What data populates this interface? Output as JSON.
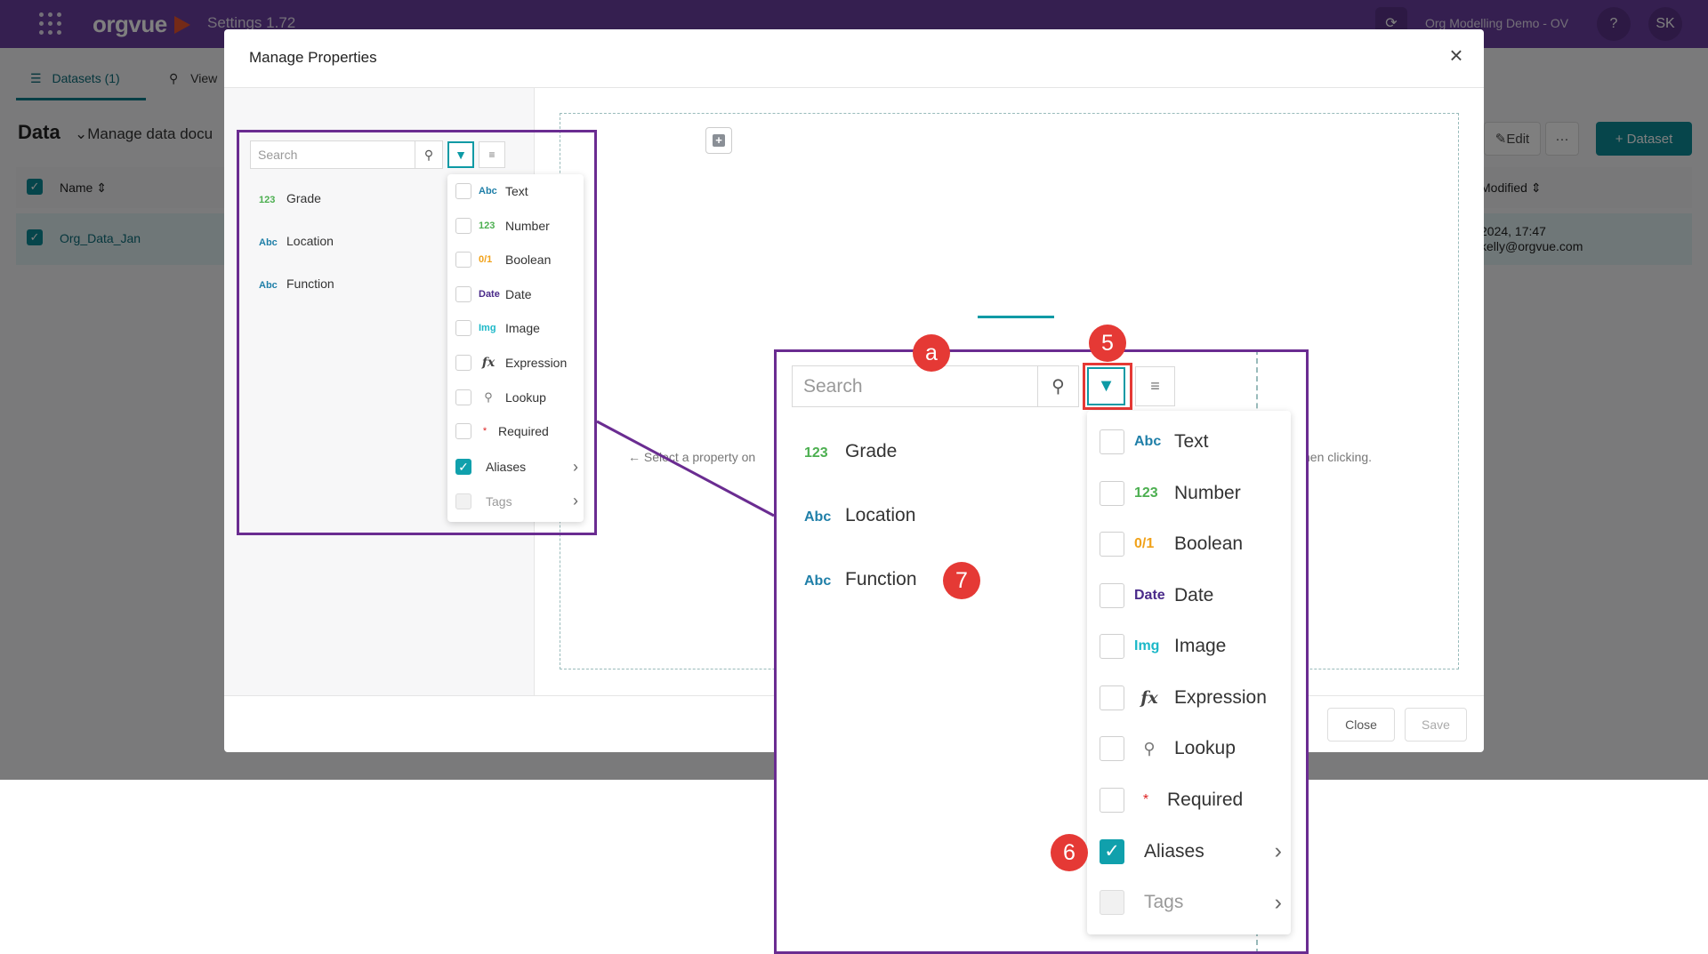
{
  "topbar": {
    "brand": "orgvue",
    "app_title": "Settings 1.72",
    "workspace": "Org Modelling Demo - OV",
    "help": "?",
    "avatar": "SK",
    "refresh_icon": "refresh-icon"
  },
  "page": {
    "tabs": [
      {
        "label": "Datasets (1)",
        "icon": "database-icon"
      },
      {
        "label": "View",
        "icon": "pin-icon"
      }
    ],
    "title": "Data",
    "subtitle": "Manage data docu",
    "header": {
      "name": "Name",
      "modified": "Modified"
    },
    "row": {
      "name": "Org_Data_Jan",
      "modified": "2024, 17:47",
      "user": "kelly@orgvue.com"
    },
    "buttons": {
      "edit": "Edit",
      "more": "···",
      "dataset": "+ Dataset"
    }
  },
  "modal": {
    "title": "Manage Properties",
    "close": "×",
    "hint_left": "Select a property on",
    "hint_right": "hen clicking.",
    "footer": {
      "close": "Close",
      "save": "Save"
    }
  },
  "panel": {
    "search_placeholder": "Search",
    "properties": [
      {
        "type_tag": "123",
        "name": "Grade",
        "kind": "num"
      },
      {
        "type_tag": "Abc",
        "name": "Location",
        "kind": "abc"
      },
      {
        "type_tag": "Abc",
        "name": "Function",
        "kind": "abc"
      }
    ],
    "filters": [
      {
        "tag": "Abc",
        "label": "Text",
        "kind": "abc",
        "checked": false
      },
      {
        "tag": "123",
        "label": "Number",
        "kind": "num",
        "checked": false
      },
      {
        "tag": "0/1",
        "label": "Boolean",
        "kind": "bool",
        "checked": false
      },
      {
        "tag": "Date",
        "label": "Date",
        "kind": "date",
        "checked": false
      },
      {
        "tag": "Img",
        "label": "Image",
        "kind": "img",
        "checked": false
      },
      {
        "tag": "fx",
        "label": "Expression",
        "kind": "fx",
        "checked": false
      },
      {
        "tag": "lookup",
        "label": "Lookup",
        "kind": "lookup",
        "checked": false
      },
      {
        "tag": "*",
        "label": "Required",
        "kind": "req",
        "checked": false
      },
      {
        "tag": "",
        "label": "Aliases",
        "kind": "aliases",
        "checked": true
      },
      {
        "tag": "",
        "label": "Tags",
        "kind": "tags",
        "checked": false
      }
    ]
  },
  "annotations": {
    "badges": [
      "a",
      "5",
      "6",
      "7"
    ],
    "colors": {
      "frame": "#6a2c91",
      "badge": "#e53935",
      "accent": "#0d8a96",
      "topbar": "#6b3fa0"
    }
  }
}
